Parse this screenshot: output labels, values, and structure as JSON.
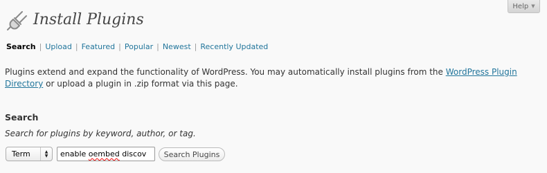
{
  "header": {
    "title": "Install Plugins",
    "icon": "plugin-icon",
    "help_label": "Help",
    "help_icon": "chevron-down-icon"
  },
  "tabs": [
    {
      "label": "Search",
      "current": true
    },
    {
      "label": "Upload",
      "current": false
    },
    {
      "label": "Featured",
      "current": false
    },
    {
      "label": "Popular",
      "current": false
    },
    {
      "label": "Newest",
      "current": false
    },
    {
      "label": "Recently Updated",
      "current": false
    }
  ],
  "intro": {
    "text_before": "Plugins extend and expand the functionality of WordPress. You may automatically install plugins from the ",
    "link_text": "WordPress Plugin Directory",
    "text_after": " or upload a plugin in .zip format via this page."
  },
  "search": {
    "heading": "Search",
    "hint": "Search for plugins by keyword, author, or tag.",
    "type_select_value": "Term",
    "input_value_before": "enable ",
    "input_value_misspelled": "oembed",
    "input_value_after": " discov",
    "button_label": "Search Plugins"
  },
  "colors": {
    "link": "#21759b",
    "background": "#f9f9f9",
    "title": "#464646",
    "spellcheck_underline": "#e00"
  }
}
